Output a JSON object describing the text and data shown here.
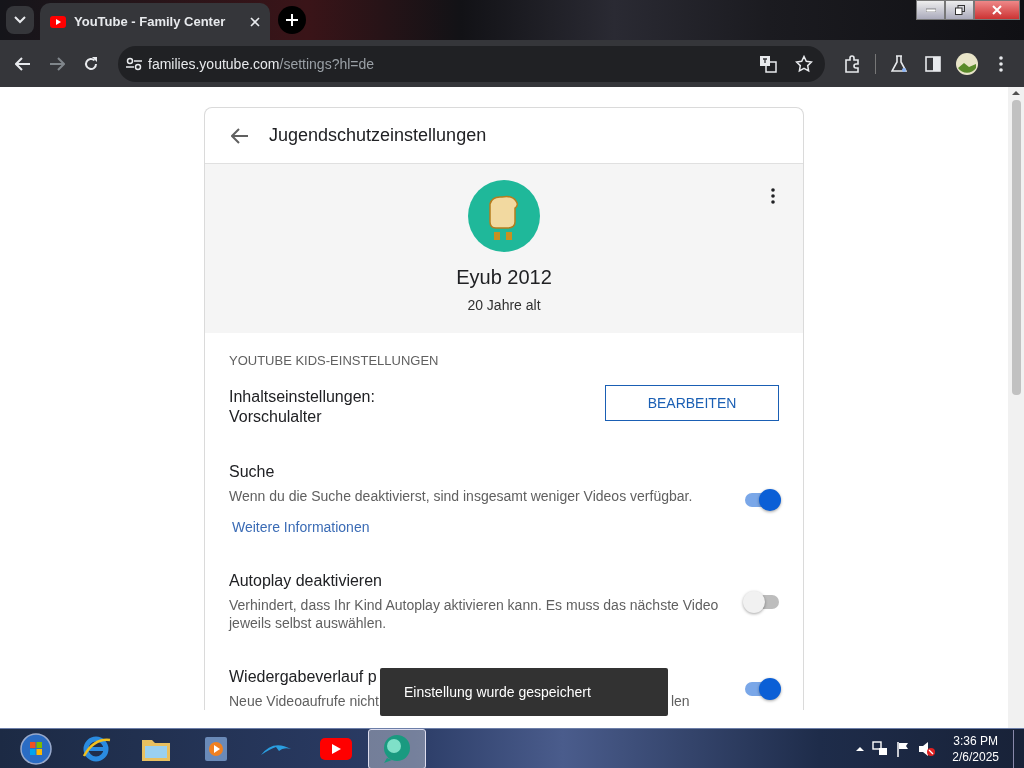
{
  "browser": {
    "tab_title": "YouTube - Family Center",
    "url_host": "families.youtube.com",
    "url_path": "/settings?hl=de"
  },
  "page": {
    "title": "Jugendschutzeinstellungen",
    "profile": {
      "name": "Eyub 2012",
      "age": "20 Jahre alt"
    },
    "section_heading": "YOUTUBE KIDS-EINSTELLUNGEN",
    "content_setting": {
      "label": "Inhaltseinstellungen:",
      "value": "Vorschulalter",
      "button": "BEARBEITEN"
    },
    "settings": [
      {
        "kind": "toggle",
        "title": "Suche",
        "description_parts": [
          "Wenn du die Suche deaktivierst, sind insgesamt weniger Videos verfügbar."
        ],
        "link": "Weitere Informationen",
        "on": true
      },
      {
        "kind": "toggle",
        "title": "Autoplay deaktivieren",
        "description_parts": [
          "Verhindert, dass Ihr Kind Autoplay aktivieren kann. Es muss das nächste Video jeweils selbst auswählen."
        ],
        "on": false
      },
      {
        "kind": "toggle",
        "title": "Wiedergabeverlauf p",
        "description_parts": [
          "Neue Videoaufrufe nicht",
          "len"
        ],
        "on": true
      }
    ],
    "toast": "Einstellung wurde gespeichert"
  },
  "taskbar": {
    "time": "3:36 PM",
    "date": "2/6/2025"
  }
}
